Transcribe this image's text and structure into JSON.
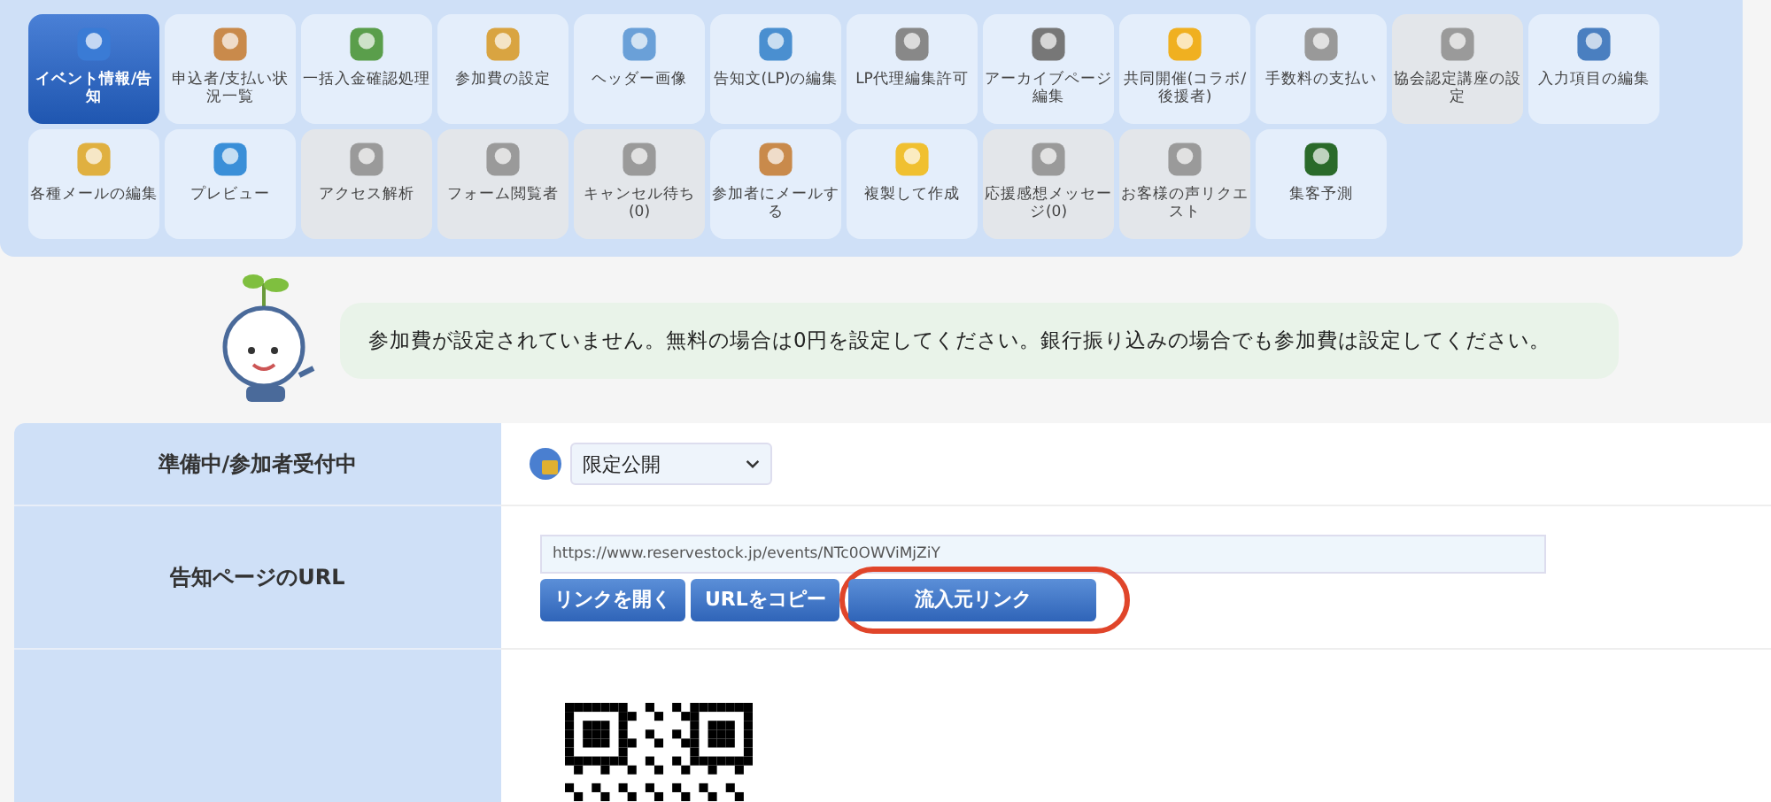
{
  "toolbar": {
    "tiles": [
      {
        "label": "イベント情報/告知",
        "selected": true,
        "disabled": false
      },
      {
        "label": "申込者/支払い状況一覧",
        "selected": false,
        "disabled": false
      },
      {
        "label": "一括入金確認処理",
        "selected": false,
        "disabled": false
      },
      {
        "label": "参加費の設定",
        "selected": false,
        "disabled": false
      },
      {
        "label": "ヘッダー画像",
        "selected": false,
        "disabled": false
      },
      {
        "label": "告知文(LP)の編集",
        "selected": false,
        "disabled": false
      },
      {
        "label": "LP代理編集許可",
        "selected": false,
        "disabled": false
      },
      {
        "label": "アーカイブページ編集",
        "selected": false,
        "disabled": false
      },
      {
        "label": "共同開催(コラボ/後援者)",
        "selected": false,
        "disabled": false
      },
      {
        "label": "手数料の支払い",
        "selected": false,
        "disabled": false
      },
      {
        "label": "協会認定講座の設定",
        "selected": false,
        "disabled": true
      },
      {
        "label": "入力項目の編集",
        "selected": false,
        "disabled": false
      },
      {
        "label": "各種メールの編集",
        "selected": false,
        "disabled": false
      },
      {
        "label": "プレビュー",
        "selected": false,
        "disabled": false
      },
      {
        "label": "アクセス解析",
        "selected": false,
        "disabled": true
      },
      {
        "label": "フォーム閲覧者",
        "selected": false,
        "disabled": true
      },
      {
        "label": "キャンセル待ち(0)",
        "selected": false,
        "disabled": true
      },
      {
        "label": "参加者にメールする",
        "selected": false,
        "disabled": false
      },
      {
        "label": "複製して作成",
        "selected": false,
        "disabled": false
      },
      {
        "label": "応援感想メッセージ(0)",
        "selected": false,
        "disabled": true
      },
      {
        "label": "お客様の声リクエスト",
        "selected": false,
        "disabled": true
      },
      {
        "label": "集客予測",
        "selected": false,
        "disabled": false
      }
    ]
  },
  "notice": {
    "message": "参加費が設定されていません。無料の場合は0円を設定してください。銀行振り込みの場合でも参加費は設定してください。"
  },
  "settings": {
    "rows": [
      {
        "kind": "select",
        "label": "準備中/参加者受付中",
        "value": "限定公開"
      },
      {
        "kind": "url",
        "label": "告知ページのURL",
        "value": "https://www.reservestock.jp/events/NTc0OWViMjZiY",
        "buttons": [
          {
            "label": "リンクを開く",
            "highlighted": false
          },
          {
            "label": "URLをコピー",
            "highlighted": false
          },
          {
            "label": "流入元リンク",
            "highlighted": true
          }
        ]
      },
      {
        "kind": "qr"
      }
    ]
  }
}
